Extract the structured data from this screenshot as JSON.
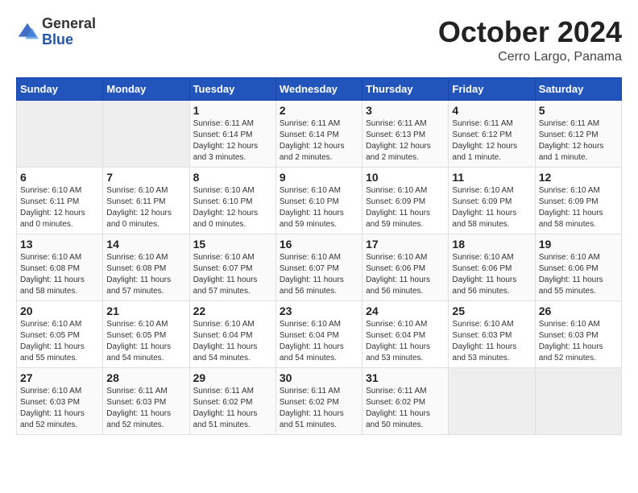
{
  "header": {
    "logo_general": "General",
    "logo_blue": "Blue",
    "month_title": "October 2024",
    "location": "Cerro Largo, Panama"
  },
  "columns": [
    "Sunday",
    "Monday",
    "Tuesday",
    "Wednesday",
    "Thursday",
    "Friday",
    "Saturday"
  ],
  "weeks": [
    [
      {
        "day": "",
        "info": ""
      },
      {
        "day": "",
        "info": ""
      },
      {
        "day": "1",
        "info": "Sunrise: 6:11 AM\nSunset: 6:14 PM\nDaylight: 12 hours and 3 minutes."
      },
      {
        "day": "2",
        "info": "Sunrise: 6:11 AM\nSunset: 6:14 PM\nDaylight: 12 hours and 2 minutes."
      },
      {
        "day": "3",
        "info": "Sunrise: 6:11 AM\nSunset: 6:13 PM\nDaylight: 12 hours and 2 minutes."
      },
      {
        "day": "4",
        "info": "Sunrise: 6:11 AM\nSunset: 6:12 PM\nDaylight: 12 hours and 1 minute."
      },
      {
        "day": "5",
        "info": "Sunrise: 6:11 AM\nSunset: 6:12 PM\nDaylight: 12 hours and 1 minute."
      }
    ],
    [
      {
        "day": "6",
        "info": "Sunrise: 6:10 AM\nSunset: 6:11 PM\nDaylight: 12 hours and 0 minutes."
      },
      {
        "day": "7",
        "info": "Sunrise: 6:10 AM\nSunset: 6:11 PM\nDaylight: 12 hours and 0 minutes."
      },
      {
        "day": "8",
        "info": "Sunrise: 6:10 AM\nSunset: 6:10 PM\nDaylight: 12 hours and 0 minutes."
      },
      {
        "day": "9",
        "info": "Sunrise: 6:10 AM\nSunset: 6:10 PM\nDaylight: 11 hours and 59 minutes."
      },
      {
        "day": "10",
        "info": "Sunrise: 6:10 AM\nSunset: 6:09 PM\nDaylight: 11 hours and 59 minutes."
      },
      {
        "day": "11",
        "info": "Sunrise: 6:10 AM\nSunset: 6:09 PM\nDaylight: 11 hours and 58 minutes."
      },
      {
        "day": "12",
        "info": "Sunrise: 6:10 AM\nSunset: 6:09 PM\nDaylight: 11 hours and 58 minutes."
      }
    ],
    [
      {
        "day": "13",
        "info": "Sunrise: 6:10 AM\nSunset: 6:08 PM\nDaylight: 11 hours and 58 minutes."
      },
      {
        "day": "14",
        "info": "Sunrise: 6:10 AM\nSunset: 6:08 PM\nDaylight: 11 hours and 57 minutes."
      },
      {
        "day": "15",
        "info": "Sunrise: 6:10 AM\nSunset: 6:07 PM\nDaylight: 11 hours and 57 minutes."
      },
      {
        "day": "16",
        "info": "Sunrise: 6:10 AM\nSunset: 6:07 PM\nDaylight: 11 hours and 56 minutes."
      },
      {
        "day": "17",
        "info": "Sunrise: 6:10 AM\nSunset: 6:06 PM\nDaylight: 11 hours and 56 minutes."
      },
      {
        "day": "18",
        "info": "Sunrise: 6:10 AM\nSunset: 6:06 PM\nDaylight: 11 hours and 56 minutes."
      },
      {
        "day": "19",
        "info": "Sunrise: 6:10 AM\nSunset: 6:06 PM\nDaylight: 11 hours and 55 minutes."
      }
    ],
    [
      {
        "day": "20",
        "info": "Sunrise: 6:10 AM\nSunset: 6:05 PM\nDaylight: 11 hours and 55 minutes."
      },
      {
        "day": "21",
        "info": "Sunrise: 6:10 AM\nSunset: 6:05 PM\nDaylight: 11 hours and 54 minutes."
      },
      {
        "day": "22",
        "info": "Sunrise: 6:10 AM\nSunset: 6:04 PM\nDaylight: 11 hours and 54 minutes."
      },
      {
        "day": "23",
        "info": "Sunrise: 6:10 AM\nSunset: 6:04 PM\nDaylight: 11 hours and 54 minutes."
      },
      {
        "day": "24",
        "info": "Sunrise: 6:10 AM\nSunset: 6:04 PM\nDaylight: 11 hours and 53 minutes."
      },
      {
        "day": "25",
        "info": "Sunrise: 6:10 AM\nSunset: 6:03 PM\nDaylight: 11 hours and 53 minutes."
      },
      {
        "day": "26",
        "info": "Sunrise: 6:10 AM\nSunset: 6:03 PM\nDaylight: 11 hours and 52 minutes."
      }
    ],
    [
      {
        "day": "27",
        "info": "Sunrise: 6:10 AM\nSunset: 6:03 PM\nDaylight: 11 hours and 52 minutes."
      },
      {
        "day": "28",
        "info": "Sunrise: 6:11 AM\nSunset: 6:03 PM\nDaylight: 11 hours and 52 minutes."
      },
      {
        "day": "29",
        "info": "Sunrise: 6:11 AM\nSunset: 6:02 PM\nDaylight: 11 hours and 51 minutes."
      },
      {
        "day": "30",
        "info": "Sunrise: 6:11 AM\nSunset: 6:02 PM\nDaylight: 11 hours and 51 minutes."
      },
      {
        "day": "31",
        "info": "Sunrise: 6:11 AM\nSunset: 6:02 PM\nDaylight: 11 hours and 50 minutes."
      },
      {
        "day": "",
        "info": ""
      },
      {
        "day": "",
        "info": ""
      }
    ]
  ]
}
